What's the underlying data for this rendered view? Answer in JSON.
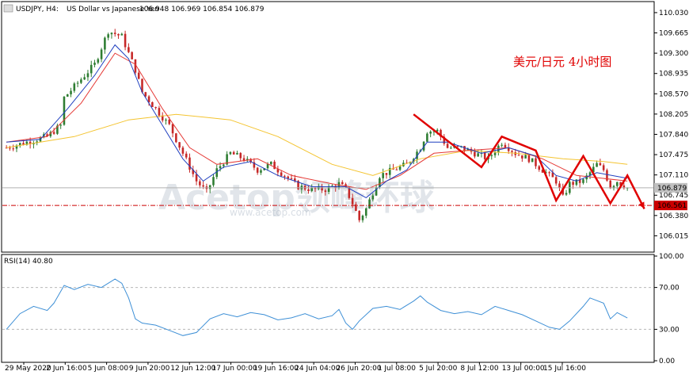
{
  "header": {
    "symbol": "USDJPY, H4:",
    "description": "US Dollar vs Japanese Yen",
    "ohlc": "106.948 106.969 106.854 106.879"
  },
  "annotation": "美元/日元 4小时图",
  "watermark": {
    "main": "Acetop领峰环球",
    "url": "www.acetop.com"
  },
  "rsi_header": "RSI(14) 40.80",
  "colors": {
    "bull": "#2e7d32",
    "bear": "#c62828",
    "ma_fast": "#1f3fbf",
    "ma_mid": "#e53935",
    "ma_slow": "#f4c430",
    "rsi": "#3d8fd6",
    "arrow": "#e00000",
    "support": "#cc0000",
    "bid": "#b0b0b0"
  },
  "chart_data": [
    {
      "type": "candlestick",
      "title": "USDJPY, H4: US Dollar vs Japanese Yen",
      "ylim": [
        105.75,
        110.2
      ],
      "y_ticks": [
        "110.030",
        "109.665",
        "109.300",
        "108.935",
        "108.570",
        "108.205",
        "107.840",
        "107.475",
        "107.110",
        "106.745",
        "106.380",
        "106.015"
      ],
      "x_ticks": [
        "29 May 2020",
        "2 Jun 16:00",
        "5 Jun 08:00",
        "9 Jun 20:00",
        "12 Jun 12:00",
        "17 Jun 00:00",
        "19 Jun 16:00",
        "24 Jun 04:00",
        "26 Jun 20:00",
        "1 Jul 08:00",
        "5 Jul 20:00",
        "8 Jul 12:00",
        "13 Jul 00:00",
        "15 Jul 16:00"
      ],
      "price_labels": {
        "current": "106.879",
        "support": "106.561"
      },
      "current_price": 106.879,
      "support_level": 106.561,
      "close_path": [
        [
          0,
          107.6
        ],
        [
          6,
          107.7
        ],
        [
          12,
          107.8
        ],
        [
          16,
          108.0
        ],
        [
          17,
          108.5
        ],
        [
          20,
          108.7
        ],
        [
          26,
          109.1
        ],
        [
          30,
          109.7
        ],
        [
          34,
          109.6
        ],
        [
          38,
          109.0
        ],
        [
          40,
          108.6
        ],
        [
          44,
          108.3
        ],
        [
          48,
          108.0
        ],
        [
          52,
          107.5
        ],
        [
          56,
          107.0
        ],
        [
          59,
          106.8
        ],
        [
          62,
          107.2
        ],
        [
          66,
          107.5
        ],
        [
          70,
          107.4
        ],
        [
          74,
          107.2
        ],
        [
          78,
          107.3
        ],
        [
          82,
          107.1
        ],
        [
          86,
          106.9
        ],
        [
          90,
          106.85
        ],
        [
          94,
          106.85
        ],
        [
          98,
          106.95
        ],
        [
          100,
          106.85
        ],
        [
          102,
          106.6
        ],
        [
          104,
          106.3
        ],
        [
          106,
          106.5
        ],
        [
          108,
          106.8
        ],
        [
          110,
          107.1
        ],
        [
          114,
          107.2
        ],
        [
          118,
          107.3
        ],
        [
          122,
          107.6
        ],
        [
          124,
          107.9
        ],
        [
          127,
          107.9
        ],
        [
          130,
          107.6
        ],
        [
          134,
          107.6
        ],
        [
          138,
          107.5
        ],
        [
          142,
          107.4
        ],
        [
          146,
          107.7
        ],
        [
          150,
          107.5
        ],
        [
          154,
          107.4
        ],
        [
          158,
          107.2
        ],
        [
          162,
          107.0
        ],
        [
          164,
          106.7
        ],
        [
          166,
          106.95
        ],
        [
          170,
          107.0
        ],
        [
          174,
          107.3
        ],
        [
          176,
          107.2
        ],
        [
          178,
          106.9
        ],
        [
          180,
          107.0
        ],
        [
          183,
          106.88
        ]
      ],
      "ma_fast_path": [
        [
          0,
          107.7
        ],
        [
          10,
          107.75
        ],
        [
          18,
          108.3
        ],
        [
          26,
          108.9
        ],
        [
          32,
          109.45
        ],
        [
          36,
          109.2
        ],
        [
          40,
          108.6
        ],
        [
          46,
          108.0
        ],
        [
          52,
          107.4
        ],
        [
          58,
          107.0
        ],
        [
          64,
          107.25
        ],
        [
          72,
          107.35
        ],
        [
          80,
          107.1
        ],
        [
          90,
          106.9
        ],
        [
          100,
          106.9
        ],
        [
          106,
          106.7
        ],
        [
          112,
          107.0
        ],
        [
          118,
          107.2
        ],
        [
          124,
          107.7
        ],
        [
          130,
          107.7
        ],
        [
          140,
          107.5
        ],
        [
          148,
          107.6
        ],
        [
          156,
          107.45
        ],
        [
          162,
          107.1
        ],
        [
          168,
          107.0
        ],
        [
          174,
          107.15
        ],
        [
          183,
          107.05
        ]
      ],
      "ma_mid_path": [
        [
          0,
          107.7
        ],
        [
          12,
          107.8
        ],
        [
          22,
          108.4
        ],
        [
          32,
          109.3
        ],
        [
          38,
          109.1
        ],
        [
          46,
          108.3
        ],
        [
          54,
          107.6
        ],
        [
          62,
          107.3
        ],
        [
          74,
          107.4
        ],
        [
          84,
          107.1
        ],
        [
          96,
          106.95
        ],
        [
          106,
          106.85
        ],
        [
          116,
          107.1
        ],
        [
          126,
          107.5
        ],
        [
          136,
          107.55
        ],
        [
          148,
          107.6
        ],
        [
          158,
          107.4
        ],
        [
          168,
          107.1
        ],
        [
          183,
          107.0
        ]
      ],
      "ma_slow_path": [
        [
          0,
          107.6
        ],
        [
          20,
          107.8
        ],
        [
          36,
          108.1
        ],
        [
          50,
          108.2
        ],
        [
          66,
          108.1
        ],
        [
          80,
          107.8
        ],
        [
          96,
          107.3
        ],
        [
          108,
          107.1
        ],
        [
          122,
          107.4
        ],
        [
          136,
          107.55
        ],
        [
          150,
          107.5
        ],
        [
          164,
          107.4
        ],
        [
          176,
          107.35
        ],
        [
          183,
          107.3
        ]
      ],
      "arrow_path": [
        [
          120,
          108.2
        ],
        [
          140,
          107.25
        ],
        [
          146,
          107.8
        ],
        [
          156,
          107.55
        ],
        [
          162,
          106.65
        ],
        [
          170,
          107.45
        ],
        [
          178,
          106.6
        ],
        [
          183,
          107.1
        ],
        [
          188,
          106.5
        ]
      ],
      "bars": 190
    },
    {
      "type": "line",
      "title": "RSI(14)",
      "ylim": [
        0,
        100
      ],
      "y_ticks": [
        "100.00",
        "70.00",
        "30.00",
        "0.00"
      ],
      "levels": [
        70,
        30
      ],
      "series": [
        {
          "name": "RSI(14)",
          "path": [
            [
              0,
              30
            ],
            [
              4,
              45
            ],
            [
              8,
              52
            ],
            [
              12,
              48
            ],
            [
              14,
              55
            ],
            [
              17,
              72
            ],
            [
              20,
              68
            ],
            [
              24,
              73
            ],
            [
              28,
              70
            ],
            [
              32,
              78
            ],
            [
              34,
              74
            ],
            [
              36,
              60
            ],
            [
              38,
              40
            ],
            [
              40,
              36
            ],
            [
              44,
              34
            ],
            [
              48,
              29
            ],
            [
              52,
              24
            ],
            [
              56,
              27
            ],
            [
              60,
              40
            ],
            [
              64,
              45
            ],
            [
              68,
              42
            ],
            [
              72,
              46
            ],
            [
              76,
              44
            ],
            [
              80,
              39
            ],
            [
              84,
              41
            ],
            [
              88,
              45
            ],
            [
              92,
              40
            ],
            [
              96,
              43
            ],
            [
              98,
              49
            ],
            [
              100,
              36
            ],
            [
              102,
              30
            ],
            [
              104,
              38
            ],
            [
              108,
              50
            ],
            [
              112,
              52
            ],
            [
              116,
              49
            ],
            [
              120,
              57
            ],
            [
              122,
              62
            ],
            [
              124,
              56
            ],
            [
              128,
              48
            ],
            [
              132,
              45
            ],
            [
              136,
              47
            ],
            [
              140,
              44
            ],
            [
              144,
              52
            ],
            [
              148,
              48
            ],
            [
              152,
              44
            ],
            [
              156,
              38
            ],
            [
              160,
              32
            ],
            [
              163,
              30
            ],
            [
              166,
              38
            ],
            [
              170,
              52
            ],
            [
              172,
              60
            ],
            [
              176,
              55
            ],
            [
              178,
              40
            ],
            [
              180,
              46
            ],
            [
              183,
              40.8
            ]
          ]
        }
      ]
    }
  ]
}
